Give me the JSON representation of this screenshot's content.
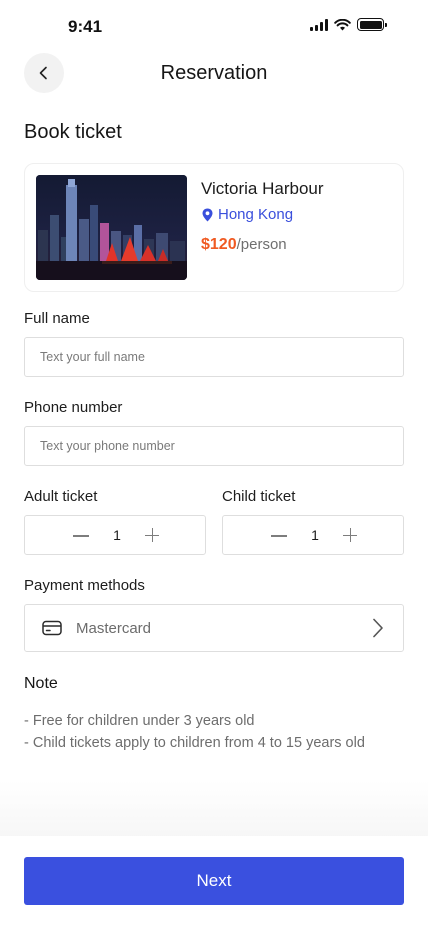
{
  "status_bar": {
    "time": "9:41"
  },
  "header": {
    "title": "Reservation"
  },
  "booking": {
    "title": "Book ticket"
  },
  "attraction": {
    "name": "Victoria Harbour",
    "location": "Hong Kong",
    "price": "$120",
    "price_unit": "/person"
  },
  "form": {
    "full_name": {
      "label": "Full name",
      "placeholder": "Text your full name",
      "value": ""
    },
    "phone": {
      "label": "Phone number",
      "placeholder": "Text your phone number",
      "value": ""
    },
    "adult_ticket": {
      "label": "Adult ticket",
      "value": "1"
    },
    "child_ticket": {
      "label": "Child ticket",
      "value": "1"
    },
    "payment": {
      "label": "Payment methods",
      "value": "Mastercard"
    }
  },
  "note": {
    "title": "Note",
    "lines": [
      "- Free for children under 3 years old",
      "- Child tickets apply to children from 4 to 15 years old"
    ]
  },
  "actions": {
    "next_label": "Next"
  },
  "colors": {
    "primary": "#3a50df",
    "price": "#f05a22",
    "location": "#3a4fdc"
  }
}
